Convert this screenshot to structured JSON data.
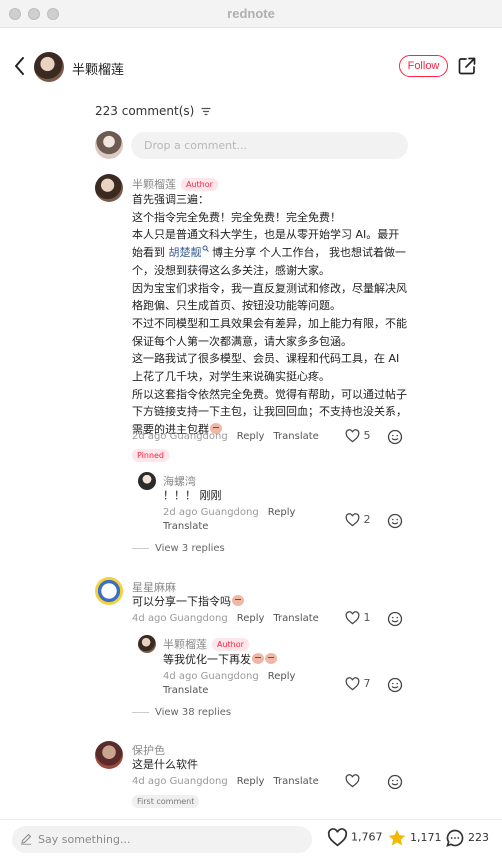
{
  "window": {
    "title": "rednote"
  },
  "header": {
    "author": "半颗榴莲",
    "follow_label": "Follow"
  },
  "comments_header": {
    "count_label": "223 comment(s)",
    "input_placeholder": "Drop a comment..."
  },
  "main_comment": {
    "user": "半颗榴莲",
    "author_tag": "Author",
    "lines": [
      "首先强调三遍：",
      "这个指令完全免费！完全免费！完全免费！",
      "本人只是普通文科大学生，也是从零开始学习 AI。最开",
      "始看到",
      "胡楚靓",
      "博主分享 个人工作台， 我也想试着做一",
      "个，没想到获得这么多关注，感谢大家。",
      "因为宝宝们求指令，我一直反复测试和修改，尽量解决风",
      "格跑偏、只生成首页、按钮没功能等问题。",
      "不过不同模型和工具效果会有差异，加上能力有限，不能",
      "保证每个人第一次都满意，请大家多多包涵。",
      "这一路我试了很多模型、会员、课程和代码工具，在 AI",
      "上花了几千块，对学生来说确实挺心疼。",
      "所以这套指令依然完全免费。觉得有帮助，可以通过帖子",
      "下方链接支持一下主包，让我回回血；不支持也没关系，",
      "需要的进主包群"
    ],
    "meta": "2d ago Guangdong",
    "reply": "Reply",
    "translate": "Translate",
    "likes": "5",
    "pinned": "Pinned",
    "sub_reply": {
      "user": "海螺湾",
      "text": "！！！ 刚刚",
      "meta": "2d ago Guangdong",
      "reply": "Reply",
      "translate": "Translate",
      "likes": "2"
    },
    "view_replies": "View 3 replies"
  },
  "comment2": {
    "user": "星星麻麻",
    "text": "可以分享一下指令吗",
    "meta": "4d ago Guangdong",
    "reply": "Reply",
    "translate": "Translate",
    "likes": "1",
    "sub_reply": {
      "user": "半颗榴莲",
      "author_tag": "Author",
      "text": "等我优化一下再发",
      "meta": "4d ago Guangdong",
      "reply": "Reply",
      "translate": "Translate",
      "likes": "7"
    },
    "view_replies": "View 38 replies"
  },
  "comment3": {
    "user": "保护色",
    "text": "这是什么软件",
    "meta": "4d ago Guangdong",
    "reply": "Reply",
    "translate": "Translate",
    "first_comment": "First comment"
  },
  "bottom_bar": {
    "say_placeholder": "Say something...",
    "likes": "1,767",
    "stars": "1,171",
    "comments": "223"
  },
  "colors": {
    "accent": "#ff2442",
    "mention": "#3b5d94",
    "star": "#f5b800"
  }
}
